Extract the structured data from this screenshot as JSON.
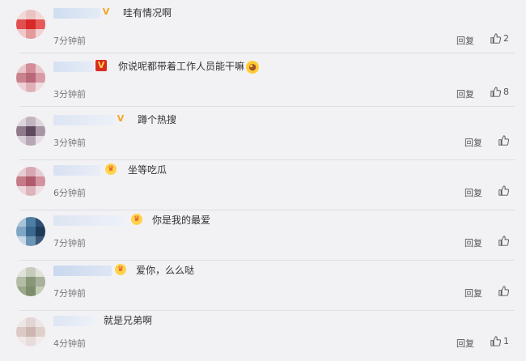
{
  "comments": [
    {
      "text": "哇有情况啊",
      "time": "7分钟前",
      "reply": "回复",
      "likes": "2",
      "badge": "v-gold",
      "badge_glyph": "V"
    },
    {
      "text": "你说呢都带着工作人员能干嘛",
      "time": "3分钟前",
      "reply": "回复",
      "likes": "8",
      "badge": "v-red",
      "badge_glyph": "V",
      "emoji": "smirk-emoji"
    },
    {
      "text": "蹲个热搜",
      "time": "3分钟前",
      "reply": "回复",
      "likes": "",
      "badge": "v-gold",
      "badge_glyph": "V"
    },
    {
      "text": "坐等吃瓜",
      "time": "6分钟前",
      "reply": "回复",
      "likes": "",
      "badge": "crown",
      "badge_glyph": "♛"
    },
    {
      "text": "你是我的最爱",
      "time": "7分钟前",
      "reply": "回复",
      "likes": "",
      "badge": "crown",
      "badge_glyph": "♛"
    },
    {
      "text": "爱你，么么哒",
      "time": "7分钟前",
      "reply": "回复",
      "likes": "",
      "badge": "crown",
      "badge_glyph": "♛"
    },
    {
      "text": "就是兄弟啊",
      "time": "4分钟前",
      "reply": "回复",
      "likes": "1",
      "badge": "",
      "badge_glyph": ""
    }
  ],
  "colors": {
    "background": "#f2f2f5",
    "vip_gold": "#f5a623",
    "vip_red": "#d92b1f"
  }
}
